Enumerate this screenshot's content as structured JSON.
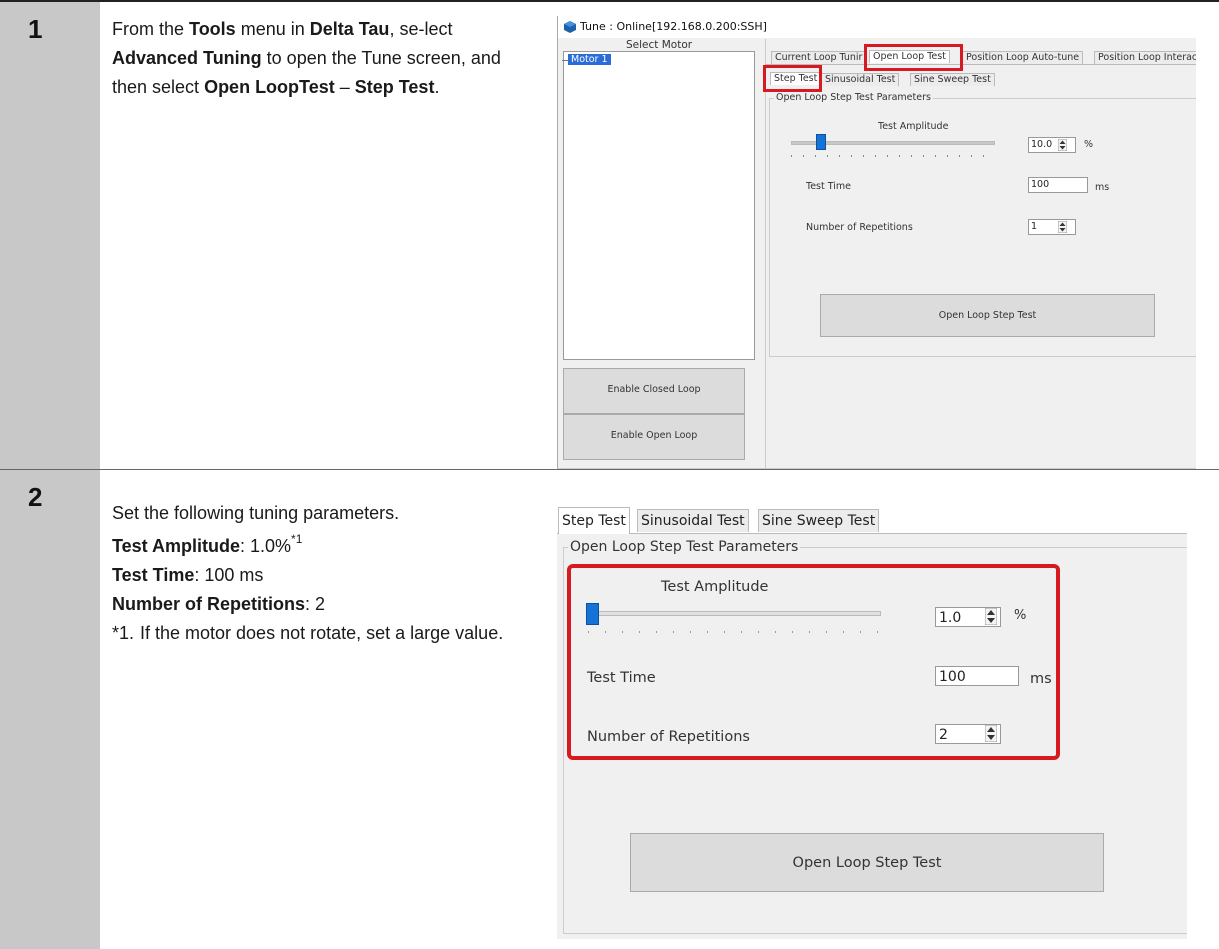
{
  "steps": [
    {
      "number": "1",
      "text": {
        "p1": "From the ",
        "b1": "Tools",
        "p2": " menu in ",
        "b2": "Delta Tau",
        "p3": ", se-lect ",
        "b3": "Advanced Tuning",
        "p4": " to open the Tune screen, and then select ",
        "b4": "Open LoopTest",
        "p5": " – ",
        "b5": "Step Test",
        "p6": "."
      }
    },
    {
      "number": "2",
      "intro": "Set the following tuning parameters.",
      "params": [
        {
          "name": "Test Amplitude",
          "value": ": 1.0%",
          "sup": "*1"
        },
        {
          "name": "Test Time",
          "value": ": 100 ms",
          "sup": ""
        },
        {
          "name": "Number of Repetitions",
          "value": ": 2",
          "sup": ""
        }
      ],
      "note_marker": "*1.",
      "note_text": "If the motor does not rotate, set a large value."
    }
  ],
  "screenshot1": {
    "title": "Tune : Online[192.168.0.200:SSH]",
    "select_motor_label": "Select Motor",
    "motor_item": "Motor 1",
    "enable_closed_loop": "Enable Closed Loop",
    "enable_open_loop": "Enable Open Loop",
    "main_tabs": [
      "Current Loop Tunir",
      "Open Loop Test",
      "Position Loop Auto-tune",
      "Position Loop Interac"
    ],
    "sub_tabs": [
      "Step Test",
      "Sinusoidal Test",
      "Sine Sweep Test"
    ],
    "group_label": "Open Loop Step Test Parameters",
    "amplitude_label": "Test Amplitude",
    "amplitude_value": "10.0",
    "amplitude_unit": "%",
    "test_time_label": "Test Time",
    "test_time_value": "100",
    "test_time_unit": "ms",
    "repetitions_label": "Number of Repetitions",
    "repetitions_value": "1",
    "run_button": "Open Loop Step Test"
  },
  "screenshot2": {
    "tabs": [
      "Step Test",
      "Sinusoidal Test",
      "Sine Sweep Test"
    ],
    "group_label": "Open Loop Step Test Parameters",
    "amplitude_label": "Test Amplitude",
    "amplitude_value": "1.0",
    "amplitude_unit": "%",
    "test_time_label": "Test Time",
    "test_time_value": "100",
    "test_time_unit": "ms",
    "repetitions_label": "Number of Repetitions",
    "repetitions_value": "2",
    "run_button": "Open Loop Step Test"
  },
  "colors": {
    "highlight_red": "#d71920",
    "slider_blue": "#1673d6",
    "selection_blue": "#2a6dd9",
    "step_column_gray": "#c8c8c8"
  }
}
